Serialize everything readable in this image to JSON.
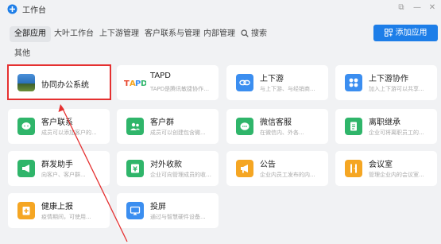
{
  "app": {
    "title": "工作台"
  },
  "tabs": [
    {
      "label": "全部应用",
      "active": true
    },
    {
      "label": "大叶工作台"
    },
    {
      "label": "上下游管理"
    },
    {
      "label": "客户联系与管理"
    },
    {
      "label": "内部管理"
    }
  ],
  "search": {
    "label": "搜索"
  },
  "add_button": {
    "label": "添加应用"
  },
  "other_tab": "其他",
  "apps": [
    {
      "name": "协同办公系统",
      "desc": "",
      "icon": "landscape-image-icon"
    },
    {
      "name": "TAPD",
      "desc": "TAPD是腾讯敏捷协作平...",
      "icon": "tapd-logo-icon"
    },
    {
      "name": "上下游",
      "desc": "与上下游、与经销商...",
      "icon": "link-icon",
      "color": "#3b8ef0"
    },
    {
      "name": "上下游协作",
      "desc": "加入上下游可以共享...",
      "icon": "grid-apps-icon",
      "color": "#3b8ef0"
    },
    {
      "name": "客户联系",
      "desc": "成员可以添加客户的...",
      "icon": "chat-bubble-icon",
      "color": "#2fb56a"
    },
    {
      "name": "客户群",
      "desc": "成员可以创建包含微...",
      "icon": "people-icon",
      "color": "#2fb56a"
    },
    {
      "name": "微信客服",
      "desc": "在微信内、外各...",
      "icon": "customer-service-icon",
      "color": "#2fb56a"
    },
    {
      "name": "离职继承",
      "desc": "企业可将离职员工的...",
      "icon": "document-icon",
      "color": "#2fb56a"
    },
    {
      "name": "群发助手",
      "desc": "向客户、客户群...",
      "icon": "megaphone-icon",
      "color": "#2fb56a"
    },
    {
      "name": "对外收款",
      "desc": "企业可向管理成员的收款...",
      "icon": "payment-icon",
      "color": "#2fb56a"
    },
    {
      "name": "公告",
      "desc": "企业内员工发布的内...",
      "icon": "announcement-icon",
      "color": "#f5a623"
    },
    {
      "name": "会议室",
      "desc": "管理企业内的会议室...",
      "icon": "door-icon",
      "color": "#f5a623"
    },
    {
      "name": "健康上报",
      "desc": "疫情期间，可使用...",
      "icon": "health-report-icon",
      "color": "#f5a623"
    },
    {
      "name": "投屏",
      "desc": "通过与智慧硬件设备...",
      "icon": "screen-cast-icon",
      "color": "#3b8ef0"
    }
  ],
  "colors": {
    "accent": "#1d7ee8",
    "highlight": "#e53030"
  }
}
